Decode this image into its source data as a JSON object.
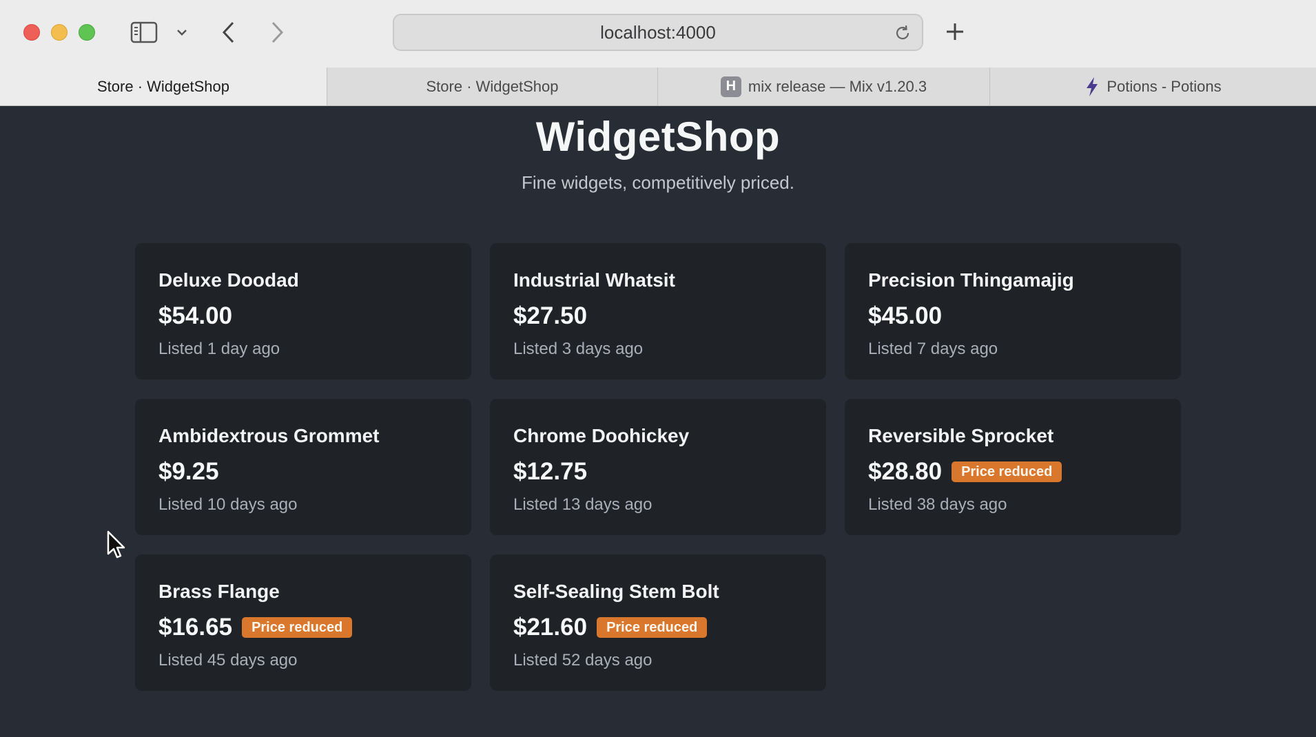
{
  "browser": {
    "url": "localhost:4000",
    "tabs": [
      {
        "label": "Store · WidgetShop",
        "active": true,
        "icon": null
      },
      {
        "label": "Store · WidgetShop",
        "active": false,
        "icon": null
      },
      {
        "label": "mix release — Mix v1.20.3",
        "active": false,
        "icon": "hex-h-favicon",
        "icon_text": "H"
      },
      {
        "label": "Potions - Potions",
        "active": false,
        "icon": "lightning-favicon"
      }
    ],
    "icons": [
      "sidebar-icon",
      "chevron-down-icon",
      "back-icon",
      "forward-icon",
      "reload-icon",
      "plus-icon"
    ]
  },
  "page": {
    "title": "WidgetShop",
    "subtitle": "Fine widgets, competitively priced."
  },
  "products": [
    {
      "name": "Deluxe Doodad",
      "price": "$54.00",
      "listed": "Listed 1 day ago",
      "badge": ""
    },
    {
      "name": "Industrial Whatsit",
      "price": "$27.50",
      "listed": "Listed 3 days ago",
      "badge": ""
    },
    {
      "name": "Precision Thingamajig",
      "price": "$45.00",
      "listed": "Listed 7 days ago",
      "badge": ""
    },
    {
      "name": "Ambidextrous Grommet",
      "price": "$9.25",
      "listed": "Listed 10 days ago",
      "badge": ""
    },
    {
      "name": "Chrome Doohickey",
      "price": "$12.75",
      "listed": "Listed 13 days ago",
      "badge": ""
    },
    {
      "name": "Reversible Sprocket",
      "price": "$28.80",
      "listed": "Listed 38 days ago",
      "badge": "Price reduced"
    },
    {
      "name": "Brass Flange",
      "price": "$16.65",
      "listed": "Listed 45 days ago",
      "badge": "Price reduced"
    },
    {
      "name": "Self-Sealing Stem Bolt",
      "price": "$21.60",
      "listed": "Listed 52 days ago",
      "badge": "Price reduced"
    }
  ],
  "colors": {
    "page_bg": "#282c34",
    "card_bg": "#1f2227",
    "badge_bg": "#d9772d"
  }
}
